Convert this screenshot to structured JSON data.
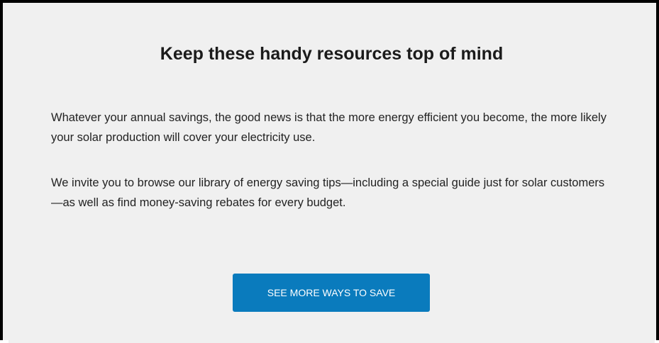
{
  "resources": {
    "heading": "Keep these handy resources top of mind",
    "paragraph_1": "Whatever your annual savings, the good news is that the more energy efficient you become, the more likely your solar production will cover your electricity use.",
    "paragraph_2": "We invite you to browse our library of energy saving tips—including a special guide just for solar customers—as well as find money-saving rebates for every budget.",
    "cta_label": "SEE MORE WAYS TO SAVE"
  },
  "colors": {
    "background": "#f0f0f0",
    "button": "#0a7bbd",
    "button_text": "#ffffff",
    "text": "#222222",
    "frame_border": "#000000"
  }
}
